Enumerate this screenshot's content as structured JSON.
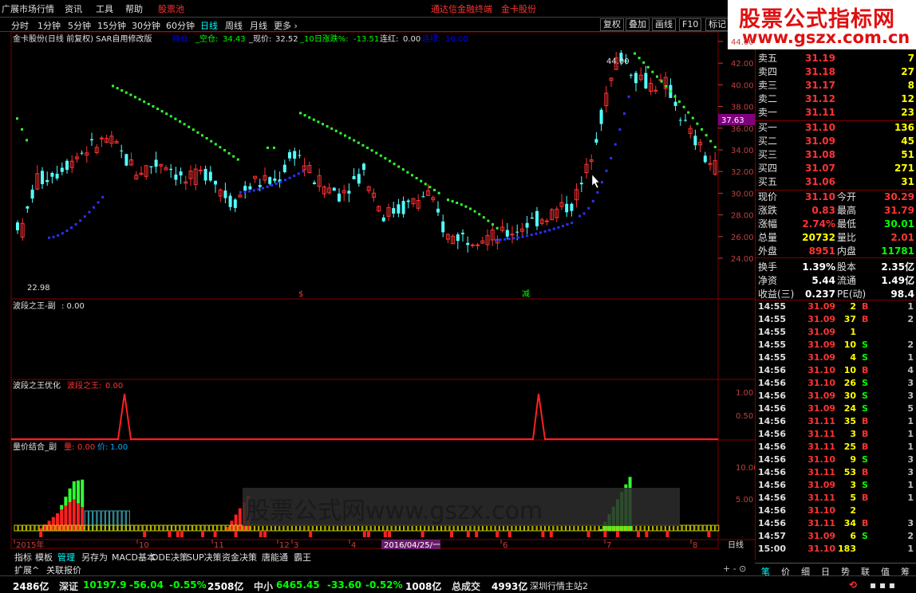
{
  "menu": {
    "items": [
      "广展市场行情",
      "资讯",
      "工具",
      "帮助",
      "股票池",
      "通达信金融终端",
      "金卡股份"
    ]
  },
  "periods": {
    "items": [
      "分时",
      "1分钟",
      "5分钟",
      "15分钟",
      "30分钟",
      "60分钟",
      "日线",
      "周线",
      "月线",
      "更多 ›"
    ],
    "selected": "日线"
  },
  "chart_tools": [
    "复权",
    "叠加",
    "画线",
    "F10",
    "标记"
  ],
  "logo": {
    "line1": "股票公式指标网",
    "line2": "www.gszx.com.cn"
  },
  "chart": {
    "info": {
      "title": "金卡股份(日线 前复权) SAR自用修改版",
      "l1": "持仓:",
      "v1": "",
      "l2": "_空仓:",
      "v2": "34.43",
      "l3": "_现价:",
      "v3": "32.52",
      "l4": "_10日涨跌%:",
      "v4": "-13.51",
      "l5": "连红:",
      "v5": "0.00",
      "l6": "连绿:",
      "v6": "16.00"
    },
    "price_axis": [
      "44.00",
      "42.00",
      "40.00",
      "38.00",
      "36.00",
      "34.00",
      "32.00",
      "30.00",
      "28.00",
      "26.00",
      "24.00"
    ],
    "high_label": "44.00",
    "low_label": "22.98",
    "current_price_tag": "37.63",
    "signal_buy": "$",
    "signal_sell": "减",
    "ind1": {
      "title": "波段之王-副",
      "value": ": 0.00"
    },
    "ind2": {
      "title": "波段之王优化",
      "l1": "波段之王:",
      "v1": "0.00",
      "axis": [
        "1.00",
        "0.50"
      ]
    },
    "ind3": {
      "title": "量价结合_副",
      "l1": "量:",
      "v1": "0.00",
      "l2": "价:",
      "v2": "1.00",
      "axis": [
        "10.00",
        "5.00"
      ]
    },
    "date_axis": [
      "2015年",
      "10",
      "11",
      "12",
      "3",
      "4",
      "5",
      "6",
      "7",
      "8"
    ],
    "date_cursor": "2016/04/25/一",
    "period_tag": "日线"
  },
  "chart_data": {
    "type": "candlestick",
    "y_range": [
      22.98,
      44.0
    ],
    "high": 44.0,
    "low": 22.98,
    "sar_green_dots": "above price (bearish)",
    "sar_blue_dots": "below price (bullish)"
  },
  "quote": {
    "asks": [
      [
        "卖五",
        "31.19",
        "7"
      ],
      [
        "卖四",
        "31.18",
        "27"
      ],
      [
        "卖三",
        "31.17",
        "8"
      ],
      [
        "卖二",
        "31.12",
        "12"
      ],
      [
        "卖一",
        "31.11",
        "23"
      ]
    ],
    "bids": [
      [
        "买一",
        "31.10",
        "136"
      ],
      [
        "买二",
        "31.09",
        "45"
      ],
      [
        "买三",
        "31.08",
        "51"
      ],
      [
        "买四",
        "31.07",
        "271"
      ],
      [
        "买五",
        "31.06",
        "31"
      ]
    ],
    "stats": [
      [
        "现价",
        "31.10",
        "今开",
        "30.29"
      ],
      [
        "涨跌",
        "0.83",
        "最高",
        "31.79"
      ],
      [
        "涨幅",
        "2.74%",
        "最低",
        "30.01"
      ],
      [
        "总量",
        "20732",
        "量比",
        "2.01"
      ],
      [
        "外盘",
        "8951",
        "内盘",
        "11781"
      ],
      [
        "换手",
        "1.39%",
        "股本",
        "2.35亿"
      ],
      [
        "净资",
        "5.44",
        "流通",
        "1.49亿"
      ],
      [
        "收益(三)",
        "0.237",
        "PE(动)",
        "98.4"
      ]
    ],
    "ticks": [
      [
        "14:55",
        "31.09",
        "2",
        "B",
        "1"
      ],
      [
        "14:55",
        "31.09",
        "37",
        "B",
        "2"
      ],
      [
        "14:55",
        "31.09",
        "1",
        "",
        ""
      ],
      [
        "14:55",
        "31.09",
        "10",
        "S",
        "2"
      ],
      [
        "14:55",
        "31.09",
        "4",
        "S",
        "1"
      ],
      [
        "14:56",
        "31.10",
        "10",
        "B",
        "4"
      ],
      [
        "14:56",
        "31.10",
        "26",
        "S",
        "3"
      ],
      [
        "14:56",
        "31.09",
        "30",
        "S",
        "3"
      ],
      [
        "14:56",
        "31.09",
        "24",
        "S",
        "5"
      ],
      [
        "14:56",
        "31.11",
        "35",
        "B",
        "1"
      ],
      [
        "14:56",
        "31.11",
        "3",
        "B",
        "1"
      ],
      [
        "14:56",
        "31.11",
        "25",
        "B",
        "1"
      ],
      [
        "14:56",
        "31.10",
        "9",
        "S",
        "3"
      ],
      [
        "14:56",
        "31.11",
        "53",
        "B",
        "3"
      ],
      [
        "14:56",
        "31.09",
        "3",
        "S",
        "1"
      ],
      [
        "14:56",
        "31.11",
        "5",
        "B",
        "1"
      ],
      [
        "14:56",
        "31.10",
        "2",
        "",
        ""
      ],
      [
        "14:56",
        "31.11",
        "34",
        "B",
        "3"
      ],
      [
        "14:57",
        "31.09",
        "6",
        "S",
        "2"
      ],
      [
        "15:00",
        "31.10",
        "183",
        "",
        "1"
      ]
    ]
  },
  "right_tabs": [
    "笔",
    "价",
    "细",
    "日",
    "势",
    "联",
    "值",
    "筹"
  ],
  "bottom_tabs": [
    "指标",
    "模板",
    "管理",
    "另存为",
    "MACD基本",
    "DDE决策",
    "SUP决策",
    "资金决策",
    "唐能通",
    "霸王"
  ],
  "expand": [
    "扩展^",
    "关联报价"
  ],
  "status": {
    "s1v": "2486亿",
    "s2l": "深证",
    "s2a": "10197.9",
    "s2b": "-56.04",
    "s2c": "-0.55%",
    "s2d": "2508亿",
    "s3l": "中小",
    "s3a": "6465.45",
    "s3b": "-33.60",
    "s3c": "-0.52%",
    "s3d": "1008亿",
    "s4l": "总成交",
    "s4v": "4993亿",
    "s5": "深圳行情主站2"
  },
  "watermark": "股票公式网www.gszx.com"
}
